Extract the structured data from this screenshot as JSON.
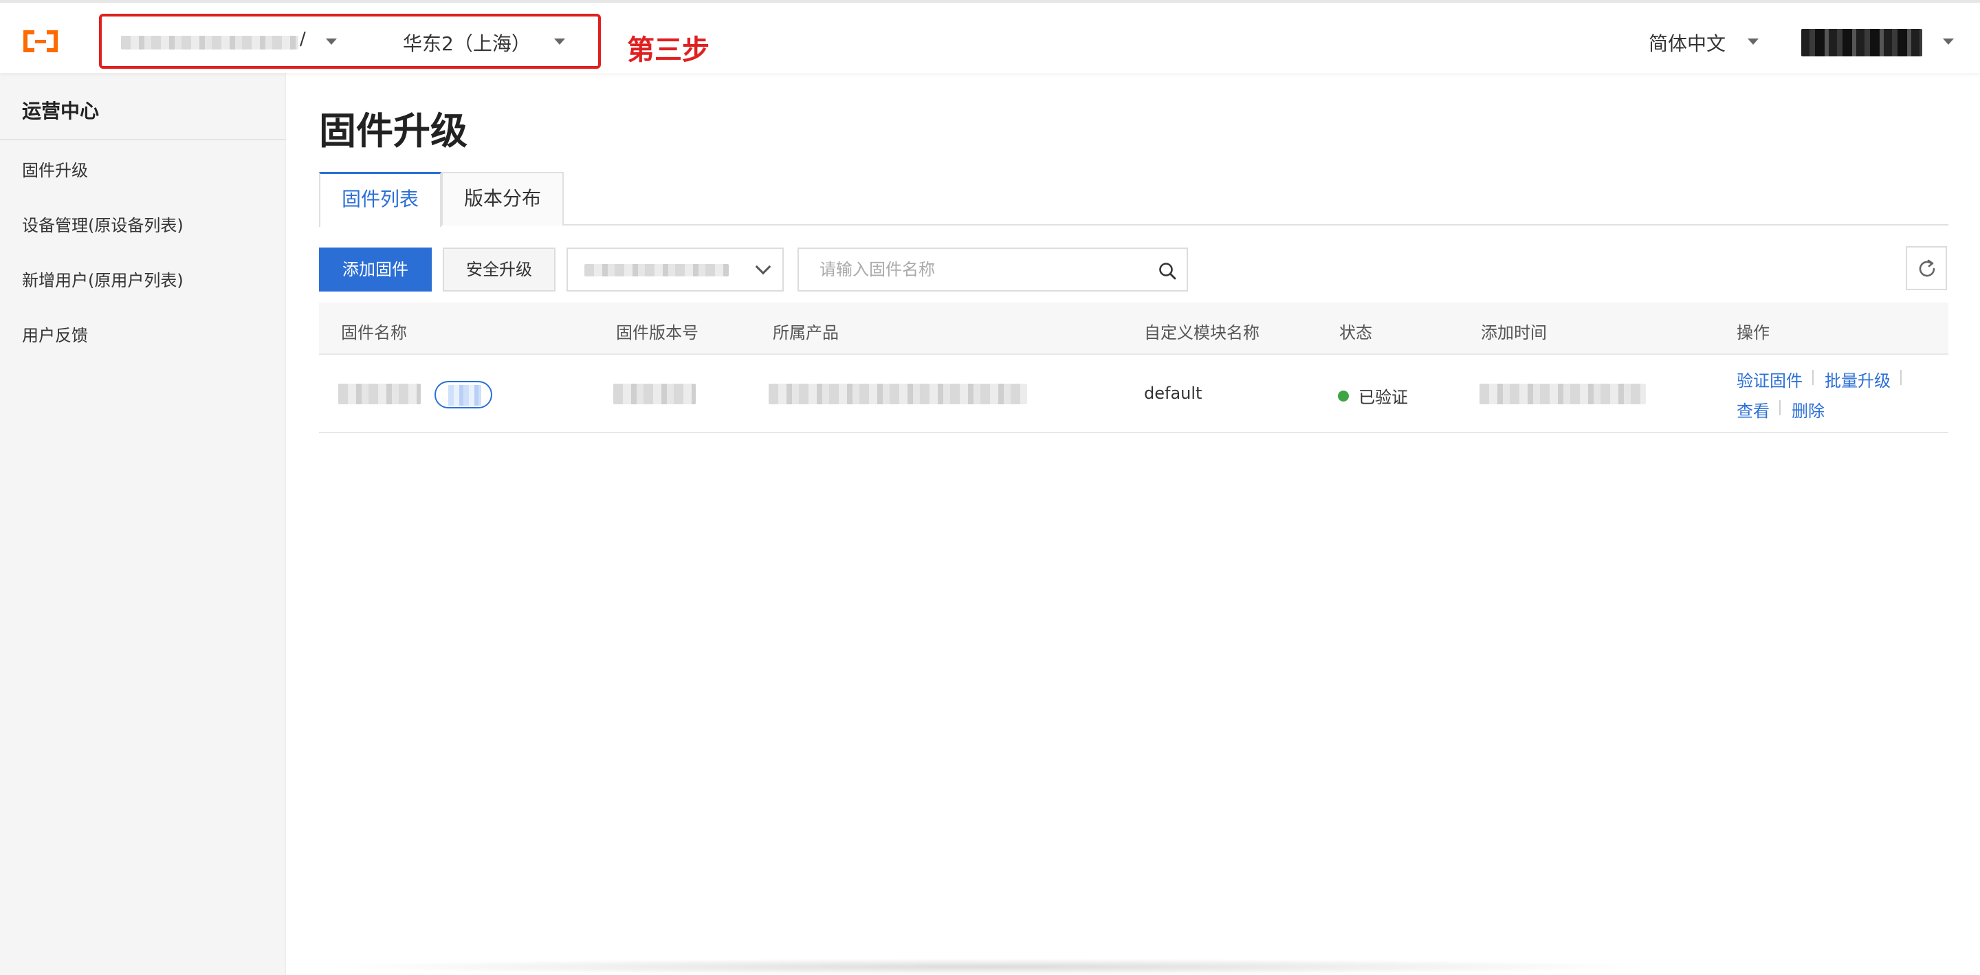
{
  "header": {
    "account_selector": {
      "suffix": "/"
    },
    "region_selector": {
      "label": "华东2（上海）"
    },
    "annotation": "第三步",
    "language": "简体中文",
    "logo_icon": "aliyun-logo-icon",
    "colors": {
      "annotation_red": "#e02020",
      "brand_orange": "#ff6a00"
    }
  },
  "sidebar": {
    "title": "运营中心",
    "items": [
      {
        "label": "固件升级"
      },
      {
        "label": "设备管理(原设备列表)"
      },
      {
        "label": "新增用户(原用户列表)"
      },
      {
        "label": "用户反馈"
      }
    ]
  },
  "main": {
    "page_title": "固件升级",
    "tabs": [
      {
        "label": "固件列表",
        "active": true
      },
      {
        "label": "版本分布",
        "active": false
      }
    ],
    "toolbar": {
      "add_label": "添加固件",
      "secure_upgrade_label": "安全升级",
      "search_placeholder": "请输入固件名称",
      "search_icon": "search-icon",
      "refresh_icon": "refresh-icon"
    },
    "table": {
      "columns": [
        "固件名称",
        "固件版本号",
        "所属产品",
        "自定义模块名称",
        "状态",
        "添加时间",
        "操作"
      ],
      "rows": [
        {
          "module_name": "default",
          "status": "已验证",
          "status_color": "#3da543",
          "actions": [
            "验证固件",
            "批量升级",
            "查看",
            "删除"
          ]
        }
      ]
    },
    "colors": {
      "primary": "#2b6fd6"
    }
  }
}
